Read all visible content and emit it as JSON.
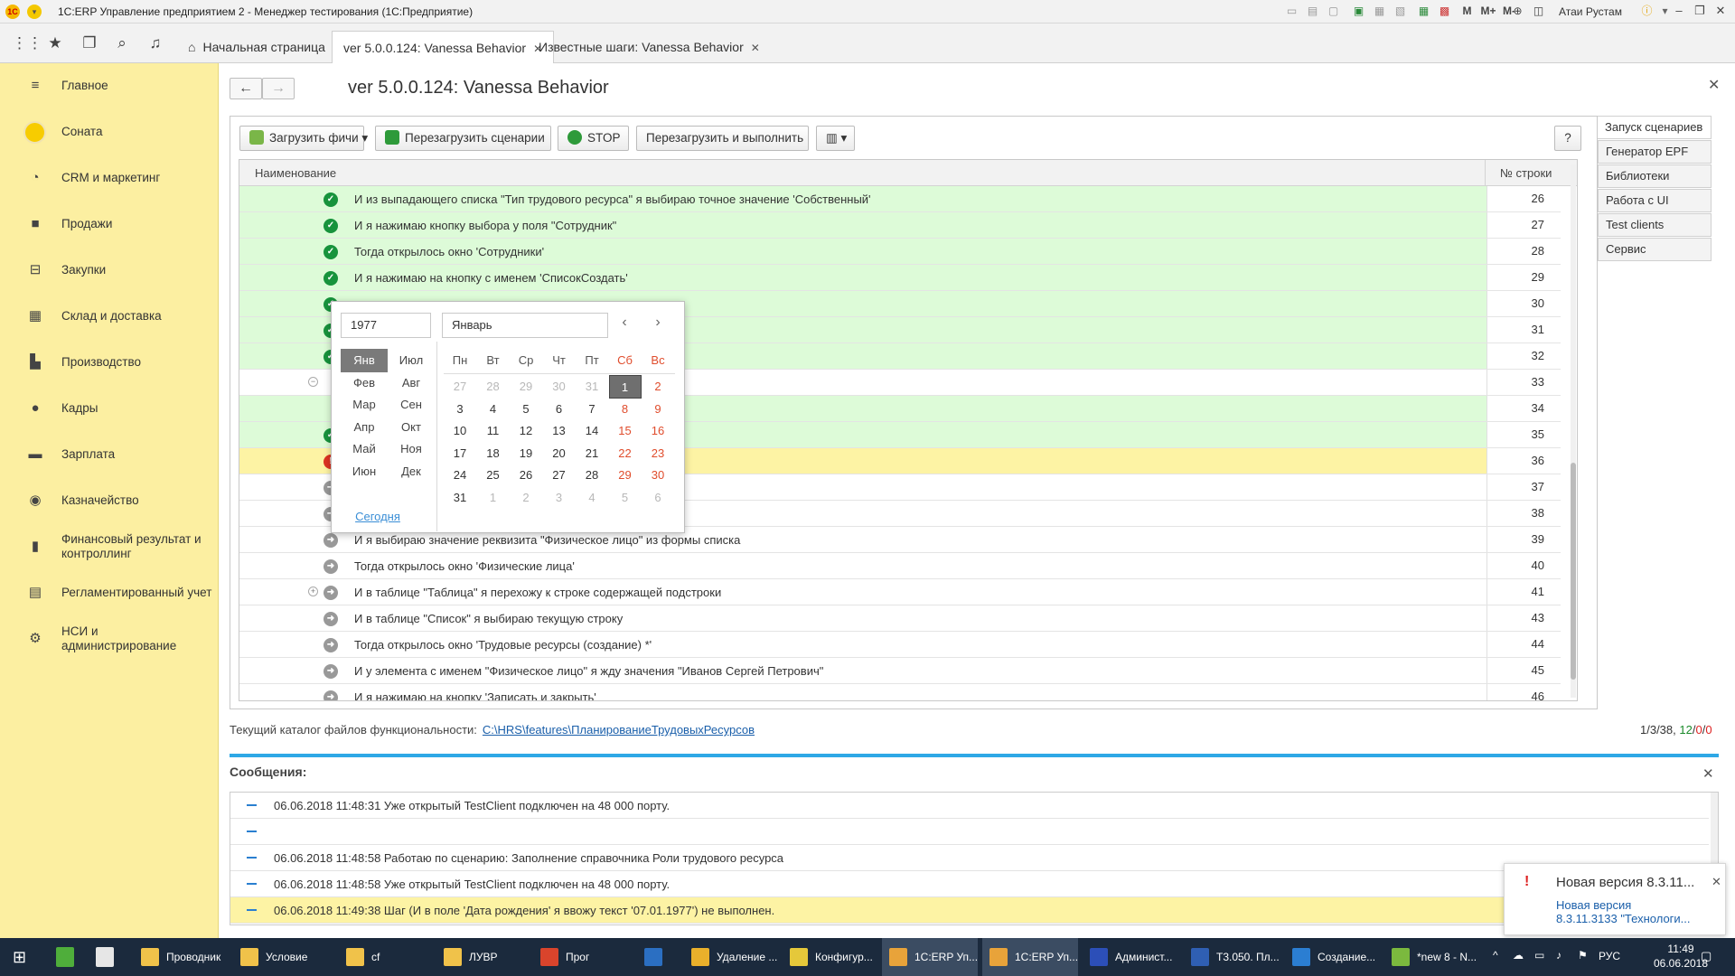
{
  "titlebar": {
    "title": "1С:ERP Управление предприятием 2 - Менеджер тестирования (1С:Предприятие)",
    "user": "Атаи Рустам",
    "m_labels": [
      "M",
      "M+",
      "M-"
    ]
  },
  "tabs": [
    {
      "label": "Начальная страница"
    },
    {
      "label": "ver 5.0.0.124: Vanessa Behavior"
    },
    {
      "label": "Известные шаги: Vanessa Behavior"
    }
  ],
  "sidebar": {
    "items": [
      {
        "label": "Главное",
        "icon": "menu-icon"
      },
      {
        "label": "Соната",
        "icon": "sonata-icon"
      },
      {
        "label": "CRM и маркетинг",
        "icon": "pie-chart-icon"
      },
      {
        "label": "Продажи",
        "icon": "bag-icon"
      },
      {
        "label": "Закупки",
        "icon": "cart-icon"
      },
      {
        "label": "Склад и доставка",
        "icon": "warehouse-icon"
      },
      {
        "label": "Производство",
        "icon": "factory-icon"
      },
      {
        "label": "Кадры",
        "icon": "people-icon"
      },
      {
        "label": "Зарплата",
        "icon": "card-icon"
      },
      {
        "label": "Казначейство",
        "icon": "coins-icon"
      },
      {
        "label": "Финансовый результат и контроллинг",
        "icon": "bar-chart-icon"
      },
      {
        "label": "Регламентированный учет",
        "icon": "document-icon"
      },
      {
        "label": "НСИ и администрирование",
        "icon": "gear-icon"
      }
    ]
  },
  "page": {
    "title": "ver 5.0.0.124: Vanessa Behavior"
  },
  "toolbar": {
    "load_features": "Загрузить фичи",
    "reload_scenarios": "Перезагрузить сценарии",
    "stop": "STOP",
    "reload_and_run": "Перезагрузить и выполнить",
    "help": "?"
  },
  "grid": {
    "columns": [
      "Наименование",
      "№ строки"
    ],
    "rows": [
      {
        "text": "И из выпадающего списка \"Тип трудового ресурса\" я выбираю точное значение 'Собственный'",
        "num": "26",
        "status": "ok",
        "bg": "green"
      },
      {
        "text": "И я нажимаю кнопку выбора у поля \"Сотрудник\"",
        "num": "27",
        "status": "ok",
        "bg": "green"
      },
      {
        "text": "Тогда открылось окно 'Сотрудники'",
        "num": "28",
        "status": "ok",
        "bg": "green"
      },
      {
        "text": "И я нажимаю на кнопку с именем 'СписокСоздать'",
        "num": "29",
        "status": "ok",
        "bg": "green"
      },
      {
        "text": "",
        "num": "30",
        "status": "ok",
        "bg": "green"
      },
      {
        "text": "'",
        "num": "31",
        "status": "ok",
        "bg": "green"
      },
      {
        "text": "",
        "num": "32",
        "status": "ok",
        "bg": "green"
      },
      {
        "text": "ние 5 секунд Тогда",
        "num": "33",
        "status": "none",
        "bg": "white"
      },
      {
        "text": "\"",
        "num": "34",
        "status": "none",
        "bg": "green"
      },
      {
        "text": "",
        "num": "35",
        "status": "ok",
        "bg": "green"
      },
      {
        "text": "",
        "num": "36",
        "status": "err",
        "bg": "yellow"
      },
      {
        "text": "",
        "num": "37",
        "status": "go",
        "bg": "white"
      },
      {
        "text": "",
        "num": "38",
        "status": "go",
        "bg": "white"
      },
      {
        "text": "И я выбираю значение реквизита \"Физическое лицо\" из формы списка",
        "num": "39",
        "status": "go",
        "bg": "white"
      },
      {
        "text": "Тогда открылось окно 'Физические лица'",
        "num": "40",
        "status": "go",
        "bg": "white"
      },
      {
        "text": "И в таблице \"Таблица\" я перехожу к строке содержащей подстроки",
        "num": "41",
        "status": "go",
        "bg": "white"
      },
      {
        "text": "И в таблице \"Список\" я выбираю текущую строку",
        "num": "43",
        "status": "go",
        "bg": "white"
      },
      {
        "text": "Тогда открылось окно 'Трудовые ресурсы (создание) *'",
        "num": "44",
        "status": "go",
        "bg": "white"
      },
      {
        "text": "И у элемента с именем \"Физическое лицо\" я жду значения \"Иванов Сергей Петрович\"",
        "num": "45",
        "status": "go",
        "bg": "white"
      },
      {
        "text": "И я нажимаю на кнопку 'Записать и закрыть'",
        "num": "46",
        "status": "go",
        "bg": "white"
      }
    ]
  },
  "right_nav": {
    "items": [
      "Запуск сценариев",
      "Генератор EPF",
      "Библиотеки",
      "Работа с UI",
      "Test clients",
      "Сервис"
    ]
  },
  "catalog": {
    "label": "Текущий каталог файлов функциональности:",
    "path": "C:\\HRS\\features\\ПланированиеТрудовыхРесурсов"
  },
  "counter": {
    "total": "1/3/38,",
    "green": "12",
    "sep": "/",
    "red1": "0",
    "red2": "0"
  },
  "messages": {
    "title": "Сообщения:",
    "items": [
      {
        "text": "06.06.2018 11:48:31 Уже открытый TestClient подключен на 48 000 порту.",
        "warn": false
      },
      {
        "text": "",
        "warn": false
      },
      {
        "text": "06.06.2018 11:48:58 Работаю по сценарию: Заполнение справочника Роли трудового ресурса",
        "warn": false
      },
      {
        "text": "06.06.2018 11:48:58 Уже открытый TestClient подключен на 48 000 порту.",
        "warn": false
      },
      {
        "text": "06.06.2018 11:49:38 Шаг (И в поле 'Дата рождения' я ввожу текст '07.01.1977') не выполнен.",
        "warn": true
      }
    ]
  },
  "toast": {
    "title": "Новая версия 8.3.11...",
    "link1": "Новая версия",
    "link2": "8.3.11.3133 \"Технологи..."
  },
  "calendar": {
    "year": "1977",
    "month": "Январь",
    "months_col1": [
      "Янв",
      "Фев",
      "Мар",
      "Апр",
      "Май",
      "Июн"
    ],
    "months_col2": [
      "Июл",
      "Авг",
      "Сен",
      "Окт",
      "Ноя",
      "Дек"
    ],
    "selected_month": "Янв",
    "today": "Сегодня",
    "weekdays": [
      "Пн",
      "Вт",
      "Ср",
      "Чт",
      "Пт",
      "Сб",
      "Вс"
    ],
    "weeks": [
      [
        "27",
        "28",
        "29",
        "30",
        "31",
        "1",
        "2"
      ],
      [
        "3",
        "4",
        "5",
        "6",
        "7",
        "8",
        "9"
      ],
      [
        "10",
        "11",
        "12",
        "13",
        "14",
        "15",
        "16"
      ],
      [
        "17",
        "18",
        "19",
        "20",
        "21",
        "22",
        "23"
      ],
      [
        "24",
        "25",
        "26",
        "27",
        "28",
        "29",
        "30"
      ],
      [
        "31",
        "1",
        "2",
        "3",
        "4",
        "5",
        "6"
      ]
    ],
    "selected_day": "1"
  },
  "taskbar": {
    "items": [
      {
        "label": "Проводник",
        "color": "#f0c24a"
      },
      {
        "label": "Условие",
        "color": "#f0c24a"
      },
      {
        "label": "cf",
        "color": "#f0c24a"
      },
      {
        "label": "ЛУВР",
        "color": "#f0c24a"
      },
      {
        "label": "Прог",
        "color": "#d9442c"
      },
      {
        "label": "",
        "color": "#2b6fc2"
      },
      {
        "label": "Удаление ...",
        "color": "#e9b02b"
      },
      {
        "label": "Конфигур...",
        "color": "#e5c83a"
      },
      {
        "label": "1С:ERP Уп...",
        "color": "#e8a33a"
      },
      {
        "label": "1С:ERP Уп...",
        "color": "#e8a33a"
      },
      {
        "label": "Админист...",
        "color": "#2c4fb8"
      },
      {
        "label": "Т3.050. Пл...",
        "color": "#2f5fb3"
      },
      {
        "label": "Создание...",
        "color": "#2b7ed2"
      },
      {
        "label": "*new 8 - N...",
        "color": "#7bb93e"
      }
    ],
    "lang": "РУС",
    "time": "11:49",
    "date": "06.06.2018"
  }
}
